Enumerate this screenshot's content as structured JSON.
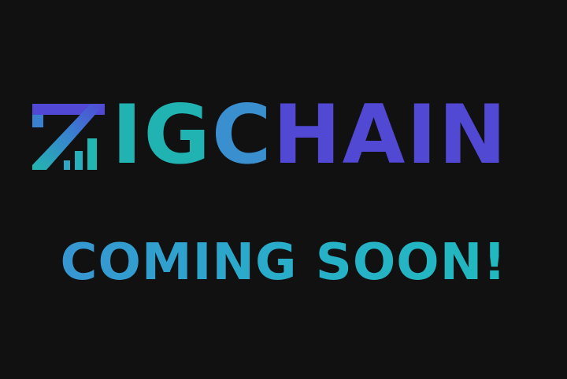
{
  "brand": {
    "name_part_1": "IG",
    "name_part_2": "C",
    "name_part_3": "HAIN",
    "logo_icon": "z-bars-logo-icon",
    "colors": {
      "background": "#111111",
      "teal": "#20b3b2",
      "blue": "#3a8fcf",
      "indigo": "#5148d4"
    }
  },
  "tagline": {
    "text": "COMING SOON!"
  }
}
